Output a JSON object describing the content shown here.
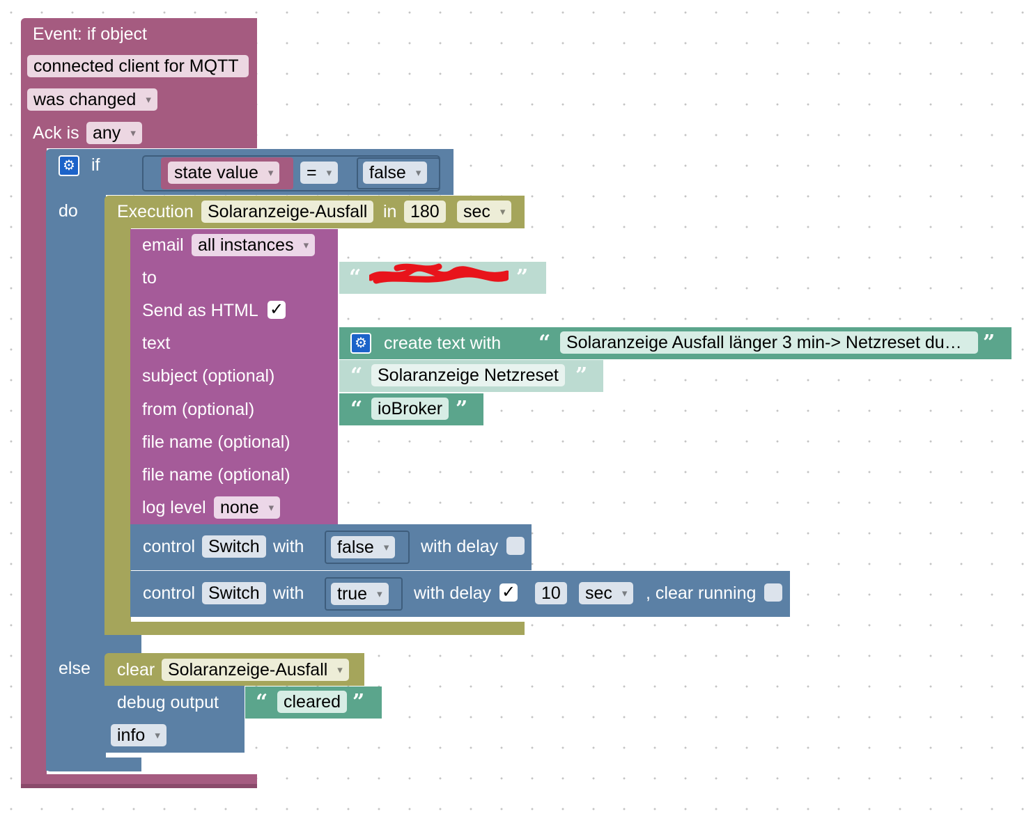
{
  "event": {
    "title": "Event: if object",
    "object": "connected client for MQTT",
    "trigger": "was changed",
    "ack_label": "Ack is",
    "ack_value": "any"
  },
  "if_block": {
    "if_label": "if",
    "do_label": "do",
    "else_label": "else",
    "condition": {
      "left": "state value",
      "operator": "=",
      "right": "false"
    }
  },
  "execution": {
    "label": "Execution",
    "name": "Solaranzeige-Ausfall",
    "in_label": "in",
    "delay": "180",
    "unit": "sec"
  },
  "email": {
    "label": "email",
    "instances": "all instances",
    "to_label": "to",
    "html_label": "Send as HTML",
    "html_checked": "✓",
    "text_label": "text",
    "create_text_label": "create text with",
    "text_value": "Solaranzeige Ausfall länger 3 min-> Netzreset du…",
    "subject_label": "subject (optional)",
    "subject_value": "Solaranzeige Netzreset",
    "from_label": "from (optional)",
    "from_value": "ioBroker",
    "file1_label": "file name (optional)",
    "file2_label": "file name (optional)",
    "log_label": "log level",
    "log_value": "none"
  },
  "control1": {
    "label": "control",
    "target": "Switch",
    "with_label": "with",
    "value": "false",
    "delay_label": "with delay"
  },
  "control2": {
    "label": "control",
    "target": "Switch",
    "with_label": "with",
    "value": "true",
    "delay_label": "with delay",
    "delay_checked": "✓",
    "delay": "10",
    "unit": "sec",
    "clear_label": ", clear running"
  },
  "else_branch": {
    "clear_label": "clear",
    "clear_target": "Solaranzeige-Ausfall",
    "debug_label": "debug output",
    "debug_text": "cleared",
    "debug_level": "info"
  },
  "quotes": {
    "open": "“",
    "close": "”"
  },
  "colors": {
    "event": "#a55b80",
    "logic": "#5b80a5",
    "timeout": "#a5a55b",
    "email": "#a55b99",
    "text": "#5ba58c",
    "text_shadow": "#bcdbd1"
  }
}
